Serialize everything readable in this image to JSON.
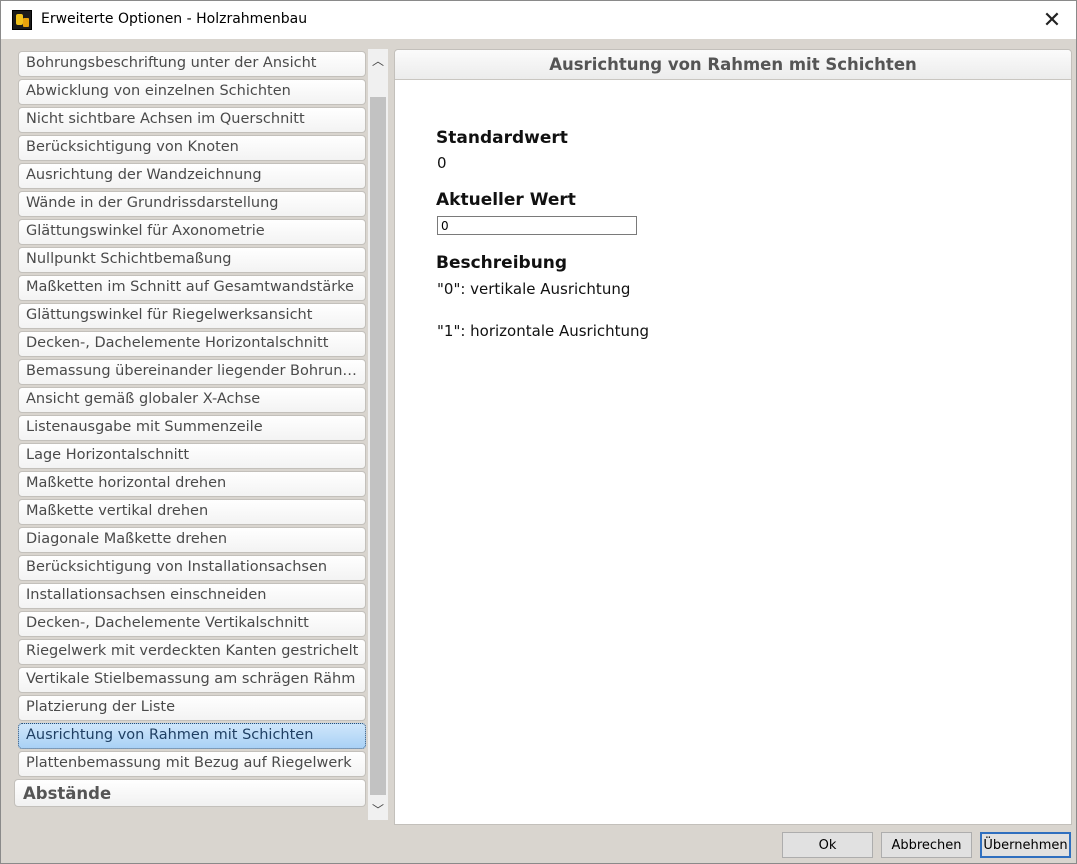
{
  "window": {
    "title": "Erweiterte Optionen - Holzrahmenbau",
    "close_glyph": "✕"
  },
  "list": {
    "items": [
      "Bohrungsbeschriftung unter der Ansicht",
      "Abwicklung von einzelnen Schichten",
      "Nicht sichtbare Achsen im Querschnitt",
      "Berücksichtigung von Knoten",
      "Ausrichtung der Wandzeichnung",
      "Wände in der Grundrissdarstellung",
      "Glättungswinkel für Axonometrie",
      "Nullpunkt Schichtbemaßung",
      "Maßketten im Schnitt auf Gesamtwandstärke",
      "Glättungswinkel für Riegelwerksansicht",
      "Decken-, Dachelemente Horizontalschnitt",
      "Bemassung übereinander liegender Bohrungen...",
      "Ansicht gemäß globaler X-Achse",
      "Listenausgabe mit Summenzeile",
      "Lage Horizontalschnitt",
      "Maßkette horizontal drehen",
      "Maßkette vertikal drehen",
      "Diagonale Maßkette drehen",
      "Berücksichtigung von Installationsachsen",
      "Installationsachsen einschneiden",
      "Decken-, Dachelemente Vertikalschnitt",
      "Riegelwerk mit verdeckten Kanten gestrichelt",
      "Vertikale Stielbemassung am schrägen Rähm",
      "Platzierung der Liste",
      "Ausrichtung von Rahmen mit Schichten",
      "Plattenbemassung mit Bezug auf Riegelwerk"
    ],
    "selected_index": 24,
    "group_label": "Abstände"
  },
  "scrollbar": {
    "up_glyph": "︿",
    "down_glyph": "﹀"
  },
  "panel": {
    "header": "Ausrichtung von Rahmen mit Schichten",
    "default_label": "Standardwert",
    "default_value": "0",
    "current_label": "Aktueller Wert",
    "current_value": "0",
    "description_label": "Beschreibung",
    "description_lines": [
      "\"0\": vertikale Ausrichtung",
      "\"1\": horizontale Ausrichtung"
    ]
  },
  "buttons": {
    "ok": "Ok",
    "cancel": "Abbrechen",
    "apply": "Übernehmen"
  },
  "colors": {
    "selection": "#a9d1f5",
    "dialog_background": "#d9d5cf",
    "default_button_border": "#2f6fbf"
  }
}
